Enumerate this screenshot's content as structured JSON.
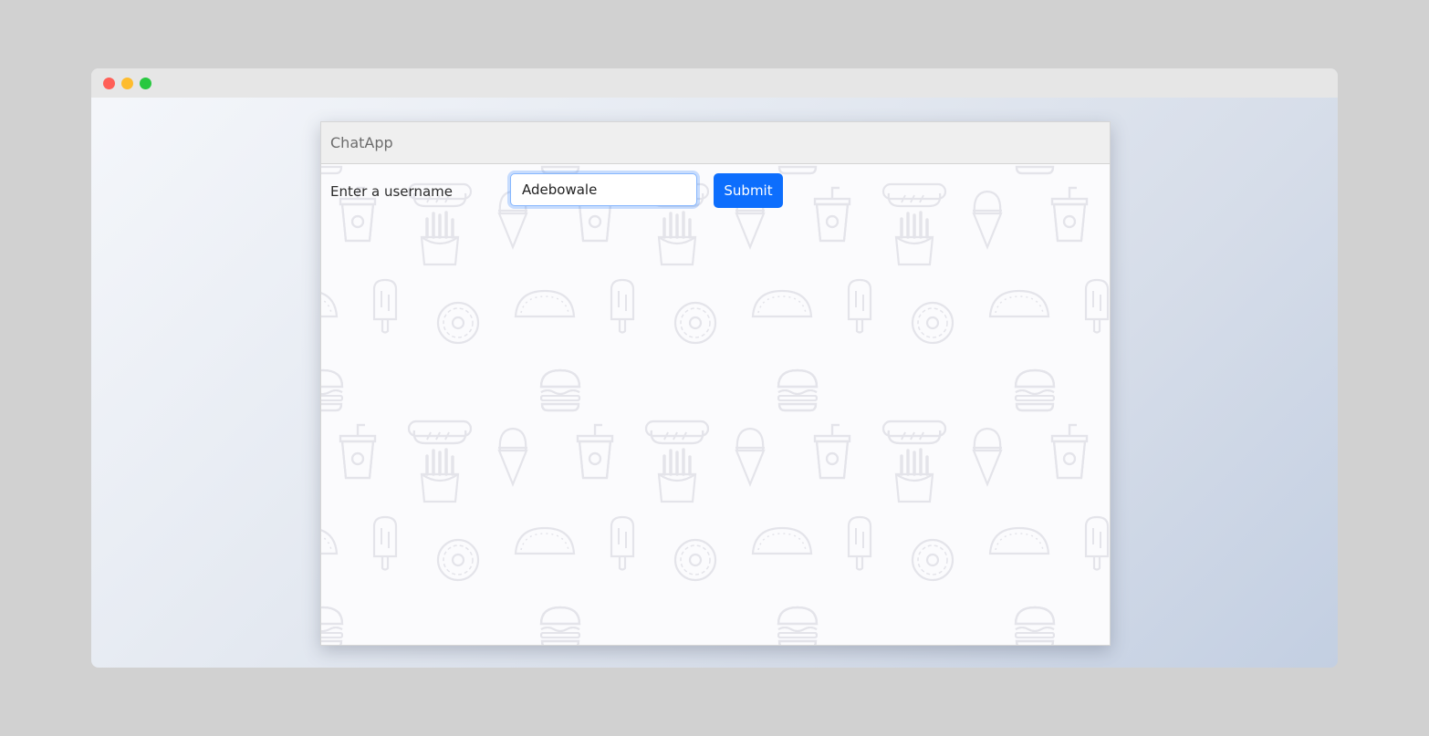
{
  "app": {
    "title": "ChatApp"
  },
  "login": {
    "label": "Enter a username",
    "input_value": "Adebowale",
    "submit_label": "Submit"
  },
  "colors": {
    "accent": "#0d6efd",
    "header_bg": "#efefef",
    "pattern_stroke": "#e4e4ea"
  },
  "background_pattern": {
    "icons": [
      "soda-cup-icon",
      "fries-icon",
      "ice-cream-icon",
      "popsicle-icon",
      "donut-icon",
      "taco-icon",
      "burger-icon",
      "hotdog-icon"
    ]
  }
}
